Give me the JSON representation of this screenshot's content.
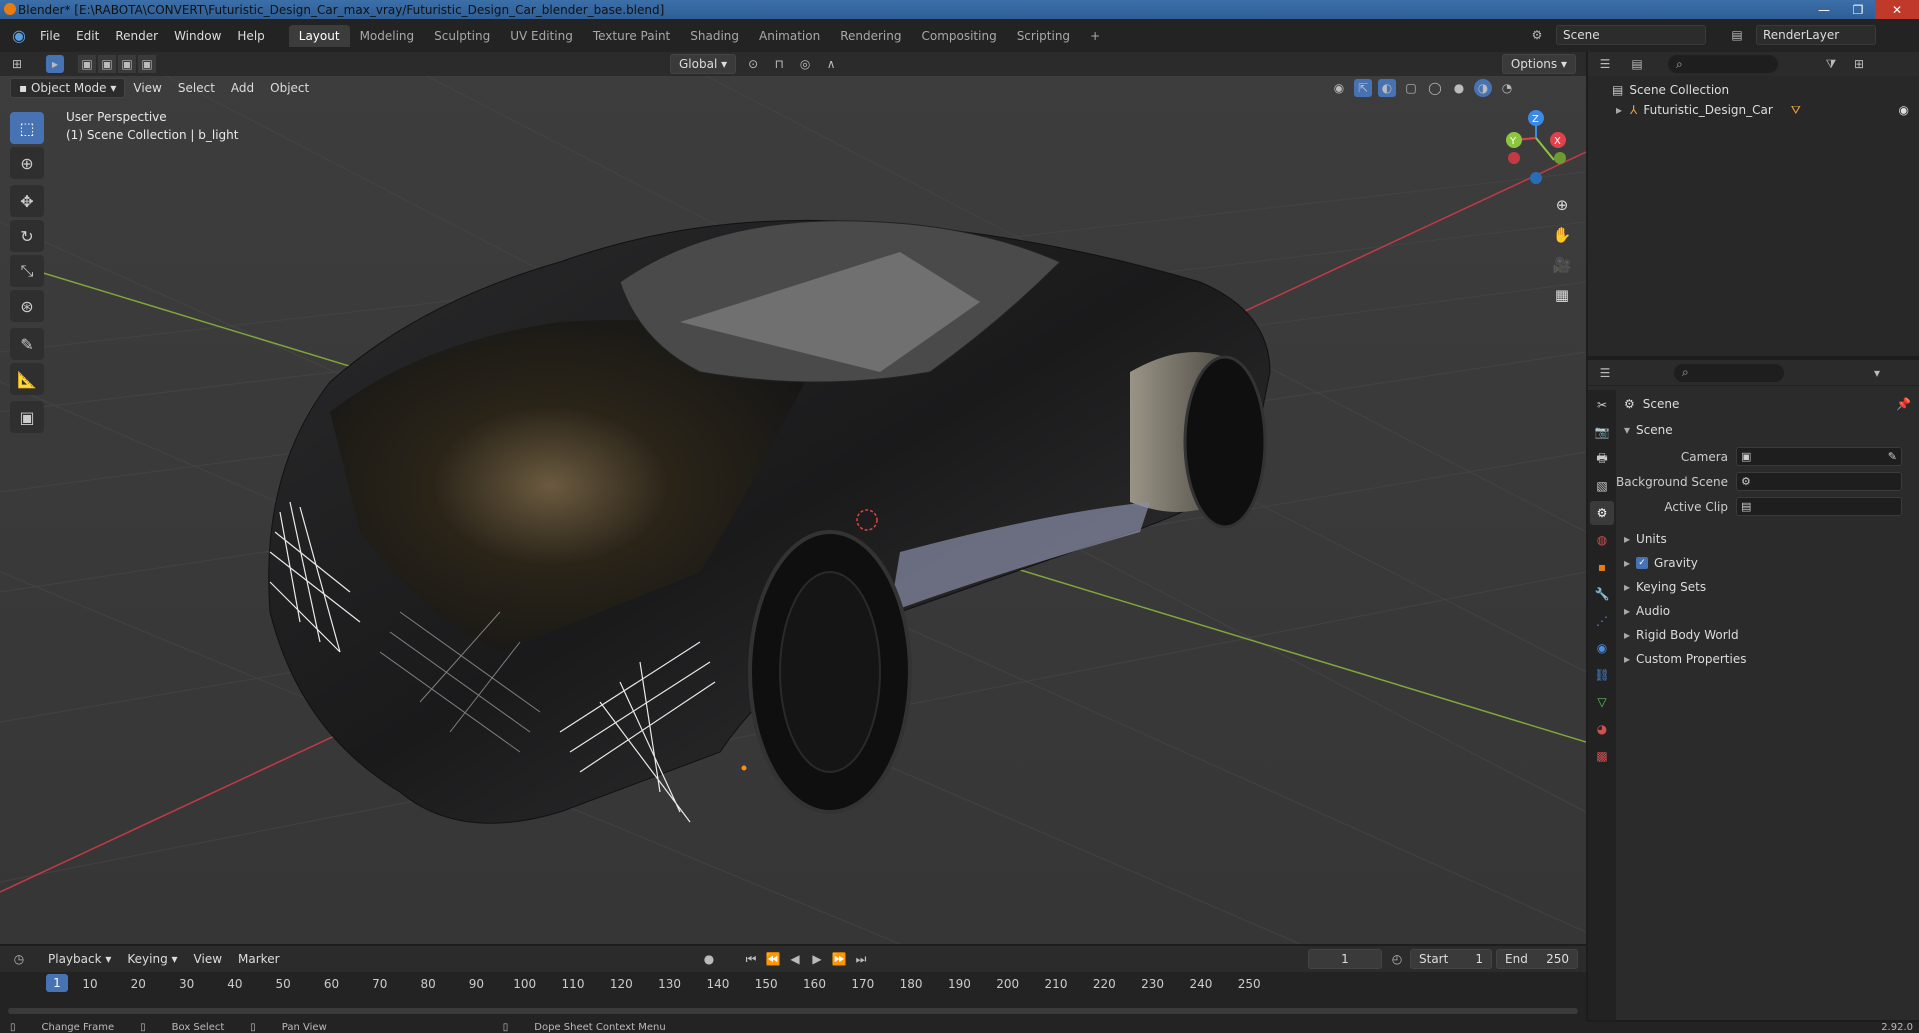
{
  "window": {
    "title": "Blender* [E:\\RABOTA\\CONVERT\\Futuristic_Design_Car_max_vray/Futuristic_Design_Car_blender_base.blend]",
    "minimize": "—",
    "maximize": "❐",
    "close": "✕"
  },
  "menu": [
    "File",
    "Edit",
    "Render",
    "Window",
    "Help"
  ],
  "workspaces": [
    "Layout",
    "Modeling",
    "Sculpting",
    "UV Editing",
    "Texture Paint",
    "Shading",
    "Animation",
    "Rendering",
    "Compositing",
    "Scripting",
    "+"
  ],
  "active_workspace": "Layout",
  "scene_name": "Scene",
  "render_layer": "RenderLayer",
  "viewport": {
    "mode": "Object Mode",
    "menus": [
      "View",
      "Select",
      "Add",
      "Object"
    ],
    "orientation": "Global",
    "options": "Options",
    "perspective": "User Perspective",
    "collection_info": "(1) Scene Collection | b_light",
    "gizmo": {
      "x": "X",
      "y": "Y",
      "z": "Z"
    }
  },
  "outliner": {
    "root": "Scene Collection",
    "items": [
      {
        "name": "Futuristic_Design_Car"
      }
    ]
  },
  "properties": {
    "header": "Scene",
    "section": "Scene",
    "rows": [
      {
        "label": "Camera",
        "value": ""
      },
      {
        "label": "Background Scene",
        "value": ""
      },
      {
        "label": "Active Clip",
        "value": ""
      }
    ],
    "subsections": [
      "Units",
      "Gravity",
      "Keying Sets",
      "Audio",
      "Rigid Body World",
      "Custom Properties"
    ],
    "gravity_checked": true
  },
  "timeline": {
    "menus": [
      "Playback",
      "Keying",
      "View",
      "Marker"
    ],
    "current_frame": "1",
    "start_label": "Start",
    "start": "1",
    "end_label": "End",
    "end": "250",
    "ticks": [
      "10",
      "20",
      "30",
      "40",
      "50",
      "60",
      "70",
      "80",
      "90",
      "100",
      "110",
      "120",
      "130",
      "140",
      "150",
      "160",
      "170",
      "180",
      "190",
      "200",
      "210",
      "220",
      "230",
      "240",
      "250"
    ]
  },
  "status": {
    "items": [
      "Change Frame",
      "Box Select",
      "Pan View",
      "Dope Sheet Context Menu"
    ],
    "version": "2.92.0"
  },
  "colors": {
    "accent": "#4772b3",
    "x_axis": "#e0414c",
    "y_axis": "#8cc63f",
    "z_axis": "#3b8ae6"
  }
}
